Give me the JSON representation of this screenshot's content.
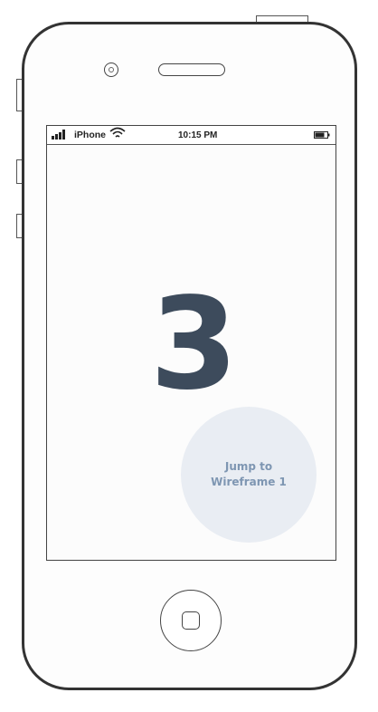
{
  "status_bar": {
    "carrier": "iPhone",
    "time": "10:15 PM",
    "signal_icon": "signal-bars-icon",
    "wifi_icon": "wifi-icon",
    "battery_icon": "battery-icon"
  },
  "screen": {
    "big_number": "3",
    "jump_button": {
      "line1": "Jump to",
      "line2": "Wireframe 1"
    }
  },
  "colors": {
    "number": "#3d4b5c",
    "jump_button_bg": "#e9edf3",
    "jump_button_text": "#7e96b2",
    "outline": "#333333"
  }
}
